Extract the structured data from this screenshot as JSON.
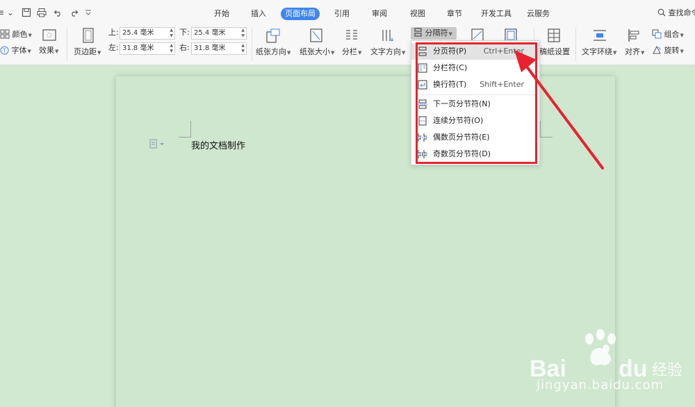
{
  "toolbar": {
    "menu_glyph": "≡ ⌄",
    "tabs": [
      "开始",
      "插入",
      "页面布局",
      "引用",
      "审阅",
      "视图",
      "章节",
      "开发工具",
      "云服务"
    ],
    "active_tab": "页面布局",
    "search": "查找命令"
  },
  "ribbon": {
    "color": "颜色",
    "font": "字体",
    "effect": "效果",
    "margins": "页边距",
    "margin_top_label": "上:",
    "margin_top": "25.4 毫米",
    "margin_bottom_label": "下:",
    "margin_bottom": "25.4 毫米",
    "margin_left_label": "左:",
    "margin_left": "31.8 毫米",
    "margin_right_label": "右:",
    "margin_right": "31.8 毫米",
    "orientation": "纸张方向",
    "size": "纸张大小",
    "columns": "分栏",
    "text_direction": "文字方向",
    "breaks": "分隔符",
    "manuscript": "稿纸设置",
    "wrap_text": "文字环绕",
    "align": "对齐",
    "group": "组合",
    "rotate": "旋转"
  },
  "breaks_menu": {
    "items": [
      {
        "label": "分页符(P)",
        "shortcut": "Ctrl+Enter",
        "icon": "page-break-icon"
      },
      {
        "label": "分栏符(C)",
        "shortcut": "",
        "icon": "column-break-icon"
      },
      {
        "label": "换行符(T)",
        "shortcut": "Shift+Enter",
        "icon": "line-break-icon"
      },
      {
        "label": "下一页分节符(N)",
        "shortcut": "",
        "icon": "next-page-section-icon"
      },
      {
        "label": "连续分节符(O)",
        "shortcut": "",
        "icon": "continuous-section-icon"
      },
      {
        "label": "偶数页分节符(E)",
        "shortcut": "",
        "icon": "even-page-section-icon"
      },
      {
        "label": "奇数页分节符(D)",
        "shortcut": "",
        "icon": "odd-page-section-icon"
      }
    ]
  },
  "document": {
    "text": "我的文档制作"
  },
  "watermark": {
    "text": "jingyan.baidu.com"
  },
  "colors": {
    "accent": "#3f86ec",
    "annotation": "#e6232e",
    "page": "#cfe7cf"
  }
}
